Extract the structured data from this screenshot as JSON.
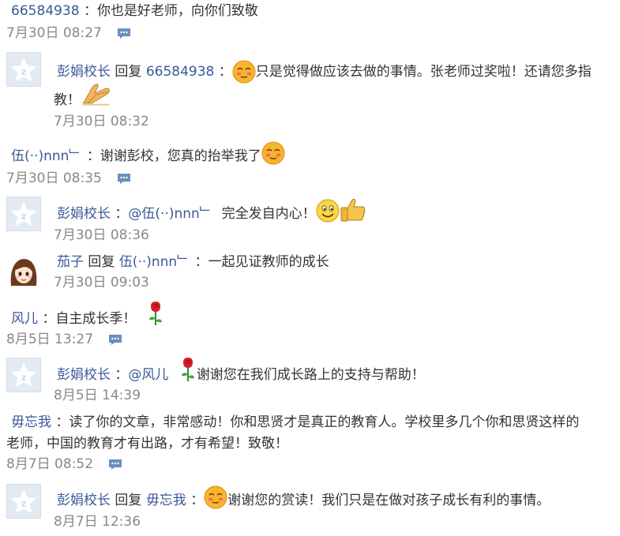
{
  "comments": [
    {
      "user": "66584938",
      "text": "你也是好老师，向你们致敬",
      "time": "7月30日 08:27"
    },
    {
      "user": "彭娟校长",
      "reply_word": "回复",
      "reply_to": "66584938",
      "text_line1": "只是觉得做应该去做的事情。张老师过奖啦！还请您多指",
      "text_line2": "教！",
      "time": "7月30日 08:32"
    },
    {
      "user": "伍(··)nnn﹂",
      "text": "谢谢彭校，您真的抬举我了",
      "time": "7月30日 08:35"
    },
    {
      "user": "彭娟校长",
      "mention": "@伍(··)nnn﹂",
      "text": "完全发自内心！",
      "time": "7月30日 08:36"
    },
    {
      "user": "茄子",
      "reply_word": "回复",
      "reply_to": "伍(··)nnn﹂",
      "text": "一起见证教师的成长",
      "time": "7月30日 09:03"
    },
    {
      "user": "风儿",
      "text": "自主成长季！",
      "time": "8月5日 13:27"
    },
    {
      "user": "彭娟校长",
      "mention": "@风儿",
      "text": "谢谢您在我们成长路上的支持与帮助！",
      "time": "8月5日 14:39"
    },
    {
      "user": "毋忘我",
      "text_line1": "读了你的文章，非常感动！你和思贤才是真正的教育人。学校里多几个你和思贤这样的",
      "text_line2": "老师，中国的教育才有出路，才有希望！致敬！",
      "time": "8月7日 08:52"
    },
    {
      "user": "彭娟校长",
      "reply_word": "回复",
      "reply_to": "毋忘我",
      "text": "谢谢您的赏读！我们只是在做对孩子成长有利的事情。",
      "time": "8月7日 12:36"
    }
  ],
  "sep": "：",
  "icons": {
    "reply": "comment-bubble-icon",
    "default_avatar": "default-avatar-icon",
    "avatar_girl": "girl-avatar",
    "emoji_shy": "shy-face-emoji",
    "emoji_bow": "praying-hands-emoji",
    "emoji_smile": "smile-face-emoji",
    "emoji_thumbs": "thumbs-up-emoji",
    "emoji_rose": "rose-emoji"
  },
  "colors": {
    "username": "#3b5998",
    "text": "#333333",
    "time": "#888888",
    "reply_icon": "#6a8fbd",
    "avatar_bg": "#e3eaf2"
  }
}
